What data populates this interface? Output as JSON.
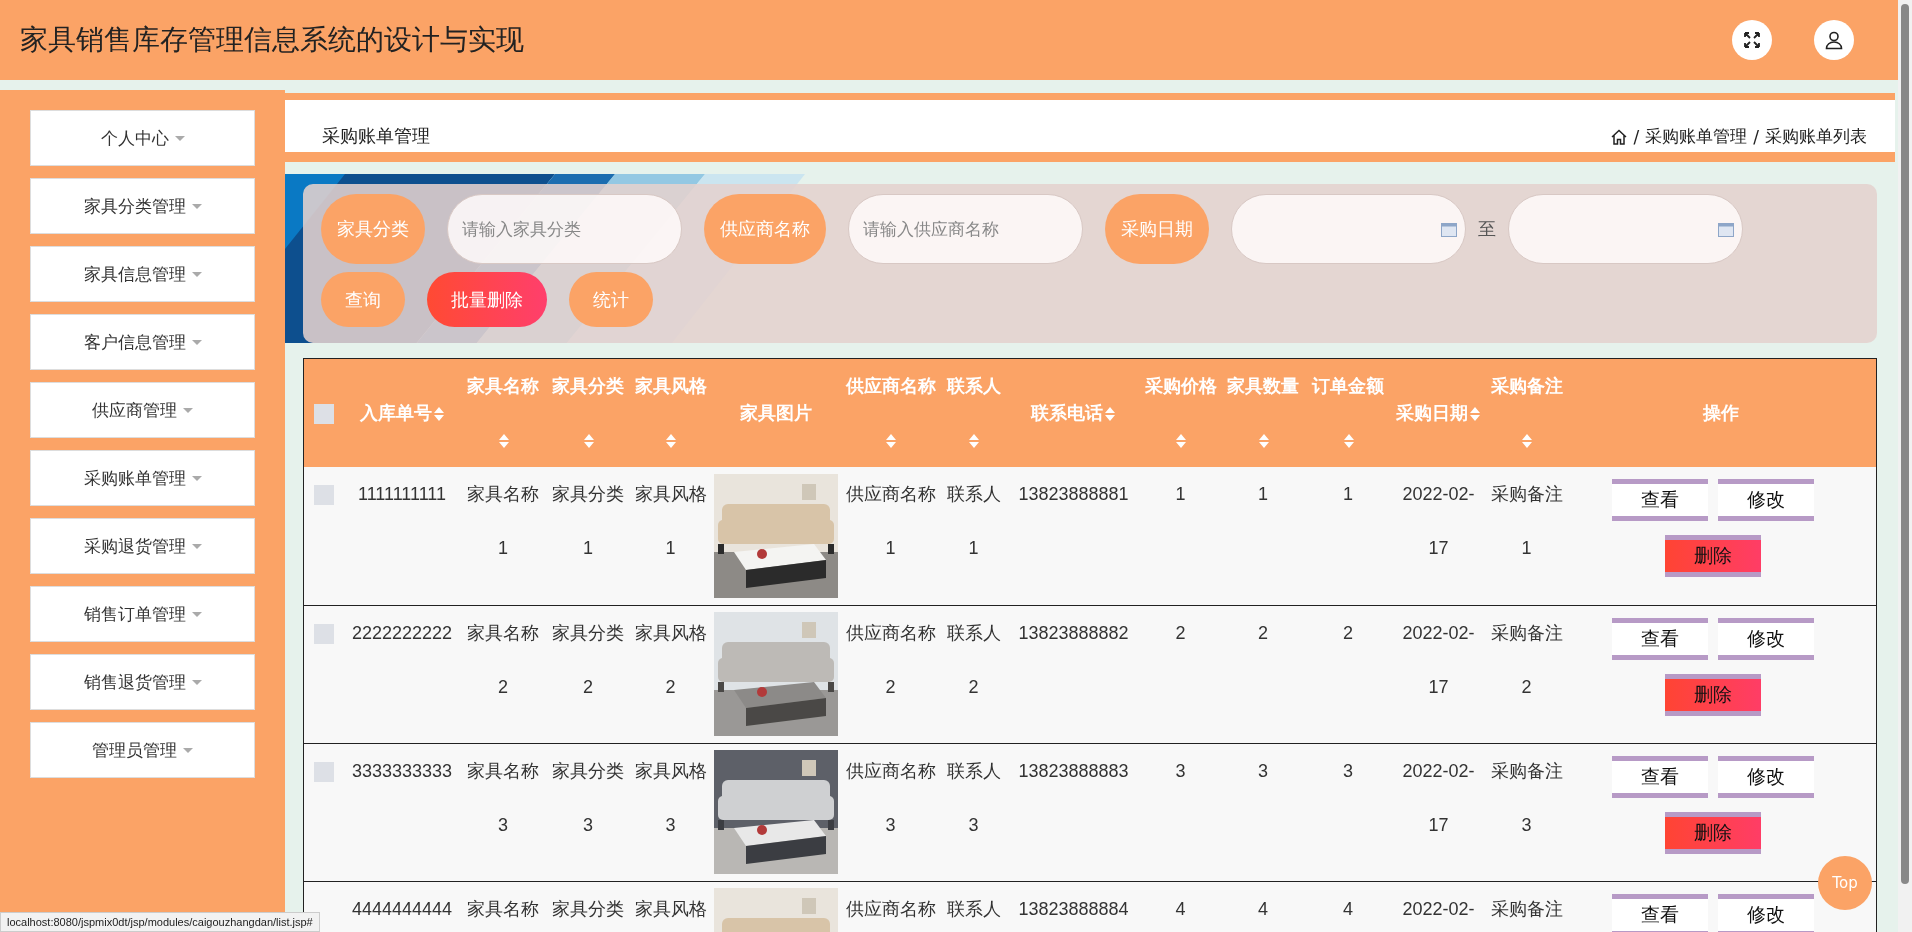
{
  "header": {
    "title": "家具销售库存管理信息系统的设计与实现"
  },
  "sidebar": {
    "items": [
      {
        "label": "个人中心"
      },
      {
        "label": "家具分类管理"
      },
      {
        "label": "家具信息管理"
      },
      {
        "label": "客户信息管理"
      },
      {
        "label": "供应商管理"
      },
      {
        "label": "采购账单管理"
      },
      {
        "label": "采购退货管理"
      },
      {
        "label": "销售订单管理"
      },
      {
        "label": "销售退货管理"
      },
      {
        "label": "管理员管理"
      }
    ]
  },
  "page": {
    "title": "采购账单管理",
    "breadcrumb": {
      "separator": "/",
      "items": [
        "采购账单管理",
        "采购账单列表"
      ]
    }
  },
  "search": {
    "fields": [
      {
        "kind": "text",
        "label": "家具分类",
        "placeholder": "请输入家具分类"
      },
      {
        "kind": "text",
        "label": "供应商名称",
        "placeholder": "请输入供应商名称"
      },
      {
        "kind": "daterange",
        "label": "采购日期",
        "separator": "至"
      }
    ],
    "buttons": [
      {
        "kind": "primary",
        "label": "查询"
      },
      {
        "kind": "danger",
        "label": "批量删除"
      },
      {
        "kind": "primary",
        "label": "统计"
      }
    ]
  },
  "table": {
    "columns": [
      {
        "kind": "checkbox",
        "checked": false
      },
      {
        "kind": "text",
        "label": "入库单号",
        "sortable": true
      },
      {
        "kind": "text",
        "label": "家具名称",
        "sortable": true
      },
      {
        "kind": "text",
        "label": "家具分类",
        "sortable": true
      },
      {
        "kind": "text",
        "label": "家具风格",
        "sortable": true
      },
      {
        "kind": "picture",
        "label": "家具图片",
        "sortable": false
      },
      {
        "kind": "text",
        "label": "供应商名称",
        "sortable": true
      },
      {
        "kind": "text",
        "label": "联系人",
        "sortable": true
      },
      {
        "kind": "text",
        "label": "联系电话",
        "sortable": true
      },
      {
        "kind": "text",
        "label": "采购价格",
        "sortable": true
      },
      {
        "kind": "text",
        "label": "家具数量",
        "sortable": true
      },
      {
        "kind": "text",
        "label": "订单金额",
        "sortable": true
      },
      {
        "kind": "text",
        "label": "采购日期",
        "sortable": true
      },
      {
        "kind": "text",
        "label": "采购备注",
        "sortable": true
      },
      {
        "kind": "actions",
        "label": "操作",
        "sortable": false
      }
    ],
    "rows": [
      {
        "cells": [
          {
            "checked": false
          },
          "1111111111",
          "家具名称1",
          "家具分类1",
          "家具风格1",
          {
            "kind": "picture"
          },
          "供应商名称1",
          "联系人1",
          "13823888881",
          "1",
          "1",
          "1",
          "2022-02-17",
          "采购备注1",
          {
            "actions": [
              {
                "kind": "default",
                "label": "查看"
              },
              {
                "kind": "default",
                "label": "修改"
              },
              {
                "kind": "danger",
                "label": "删除"
              }
            ]
          }
        ]
      },
      {
        "cells": [
          {
            "checked": false
          },
          "2222222222",
          "家具名称2",
          "家具分类2",
          "家具风格2",
          {
            "kind": "picture"
          },
          "供应商名称2",
          "联系人2",
          "13823888882",
          "2",
          "2",
          "2",
          "2022-02-17",
          "采购备注2",
          {
            "actions": [
              {
                "kind": "default",
                "label": "查看"
              },
              {
                "kind": "default",
                "label": "修改"
              },
              {
                "kind": "danger",
                "label": "删除"
              }
            ]
          }
        ]
      },
      {
        "cells": [
          {
            "checked": false
          },
          "3333333333",
          "家具名称3",
          "家具分类3",
          "家具风格3",
          {
            "kind": "picture"
          },
          "供应商名称3",
          "联系人3",
          "13823888883",
          "3",
          "3",
          "3",
          "2022-02-17",
          "采购备注3",
          {
            "actions": [
              {
                "kind": "default",
                "label": "查看"
              },
              {
                "kind": "default",
                "label": "修改"
              },
              {
                "kind": "danger",
                "label": "删除"
              }
            ]
          }
        ]
      },
      {
        "cells": [
          {},
          "4444444444",
          "家具名称",
          "家具分类",
          "家具风格",
          {
            "kind": "picture"
          },
          "供应商名称",
          "联系人",
          "13823888884",
          "4",
          "4",
          "4",
          "2022-02-",
          "采购备注",
          {
            "actions": [
              {
                "kind": "default",
                "label": "查看"
              },
              {
                "kind": "default",
                "label": "修改"
              }
            ]
          }
        ]
      }
    ]
  },
  "top_button": {
    "label": "Top"
  },
  "status_bar": {
    "url": "localhost:8080/jspmix0dt/jsp/modules/caigouzhangdan/list.jsp#"
  }
}
